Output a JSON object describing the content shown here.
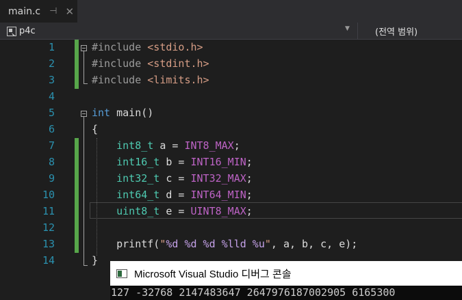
{
  "tab": {
    "title": "main.c",
    "pin_glyph": "⊣",
    "close_glyph": "✕"
  },
  "nav": {
    "project": "p4c",
    "scope": "(전역 범위)",
    "dropdown_glyph": "▼"
  },
  "lines": [
    {
      "n": "1",
      "tokens": [
        [
          "c-pre",
          "#include "
        ],
        [
          "c-inc",
          "<stdio.h>"
        ]
      ]
    },
    {
      "n": "2",
      "tokens": [
        [
          "c-pre",
          "#include "
        ],
        [
          "c-inc",
          "<stdint.h>"
        ]
      ]
    },
    {
      "n": "3",
      "tokens": [
        [
          "c-pre",
          "#include "
        ],
        [
          "c-inc",
          "<limits.h>"
        ]
      ]
    },
    {
      "n": "4",
      "tokens": []
    },
    {
      "n": "5",
      "tokens": [
        [
          "c-kw",
          "int"
        ],
        [
          "c-plain",
          " main()"
        ]
      ]
    },
    {
      "n": "6",
      "tokens": [
        [
          "c-plain",
          "{"
        ]
      ]
    },
    {
      "n": "7",
      "tokens": [
        [
          "c-plain",
          "    "
        ],
        [
          "c-type",
          "int8_t"
        ],
        [
          "c-plain",
          " a = "
        ],
        [
          "c-macro",
          "INT8_MAX"
        ],
        [
          "c-plain",
          ";"
        ]
      ]
    },
    {
      "n": "8",
      "tokens": [
        [
          "c-plain",
          "    "
        ],
        [
          "c-type",
          "int16_t"
        ],
        [
          "c-plain",
          " b = "
        ],
        [
          "c-macro",
          "INT16_MIN"
        ],
        [
          "c-plain",
          ";"
        ]
      ]
    },
    {
      "n": "9",
      "tokens": [
        [
          "c-plain",
          "    "
        ],
        [
          "c-type",
          "int32_t"
        ],
        [
          "c-plain",
          " c = "
        ],
        [
          "c-macro",
          "INT32_MAX"
        ],
        [
          "c-plain",
          ";"
        ]
      ]
    },
    {
      "n": "10",
      "tokens": [
        [
          "c-plain",
          "    "
        ],
        [
          "c-type",
          "int64_t"
        ],
        [
          "c-plain",
          " d = "
        ],
        [
          "c-macro",
          "INT64_MIN"
        ],
        [
          "c-plain",
          ";"
        ]
      ]
    },
    {
      "n": "11",
      "tokens": [
        [
          "c-plain",
          "    "
        ],
        [
          "c-type",
          "uint8_t"
        ],
        [
          "c-plain",
          " e = "
        ],
        [
          "c-macro",
          "UINT8_MAX"
        ],
        [
          "c-plain",
          ";"
        ]
      ]
    },
    {
      "n": "12",
      "tokens": []
    },
    {
      "n": "13",
      "tokens": [
        [
          "c-plain",
          "    printf("
        ],
        [
          "c-str",
          "\""
        ],
        [
          "c-fmt",
          "%d %d %d %lld %u"
        ],
        [
          "c-str",
          "\""
        ],
        [
          "c-plain",
          ", a, b, c, e);"
        ]
      ]
    },
    {
      "n": "14",
      "tokens": [
        [
          "c-plain",
          "}"
        ]
      ]
    }
  ],
  "console": {
    "title": "Microsoft Visual Studio 디버그 콘솔",
    "output": "127 -32768 2147483647 2647976187002905 6165300"
  }
}
